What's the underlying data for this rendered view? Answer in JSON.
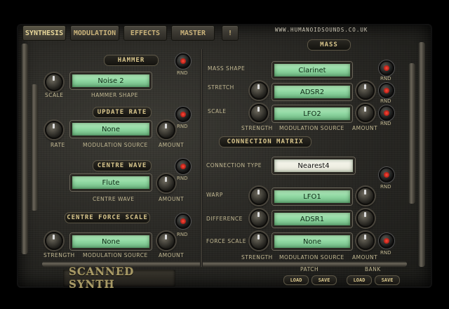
{
  "nav": {
    "tabs": [
      "SYNTHESIS",
      "MODULATION",
      "EFFECTS",
      "MASTER",
      "!"
    ],
    "url": "WWW.HUMANOIDSOUNDS.CO.UK"
  },
  "hammer": {
    "header": "HAMMER",
    "scale_label": "SCALE",
    "shape_value": "Noise 2",
    "shape_label": "HAMMER SHAPE",
    "rnd": "RND"
  },
  "update_rate": {
    "header": "UPDATE RATE",
    "rate_label": "RATE",
    "source_value": "None",
    "source_label": "MODULATION SOURCE",
    "amount_label": "AMOUNT",
    "rnd": "RND"
  },
  "centre_wave": {
    "header": "CENTRE WAVE",
    "value": "Flute",
    "label": "CENTRE WAVE",
    "amount_label": "AMOUNT",
    "rnd": "RND"
  },
  "centre_force": {
    "header": "CENTRE FORCE SCALE",
    "strength_label": "STRENGTH",
    "source_value": "None",
    "source_label": "MODULATION SOURCE",
    "amount_label": "AMOUNT",
    "rnd": "RND"
  },
  "mass": {
    "header": "MASS",
    "shape_label": "MASS SHAPE",
    "shape_value": "Clarinet",
    "stretch_label": "STRETCH",
    "stretch_value": "ADSR2",
    "scale_label": "SCALE",
    "scale_value": "LFO2",
    "strength_label": "STRENGTH",
    "source_label": "MODULATION SOURCE",
    "amount_label": "AMOUNT",
    "rnd": "RND"
  },
  "matrix": {
    "header": "CONNECTION MATRIX",
    "type_label": "CONNECTION TYPE",
    "type_value": "Nearest4",
    "warp_label": "WARP",
    "warp_value": "LFO1",
    "difference_label": "DIFFERENCE",
    "difference_value": "ADSR1",
    "force_label": "FORCE SCALE",
    "force_value": "None",
    "strength_label": "STRENGTH",
    "source_label": "MODULATION SOURCE",
    "amount_label": "AMOUNT",
    "rnd": "RND"
  },
  "footer": {
    "logo": "SCANNED SYNTH",
    "patch_label": "PATCH",
    "bank_label": "BANK",
    "load": "LOAD",
    "save": "SAVE"
  }
}
